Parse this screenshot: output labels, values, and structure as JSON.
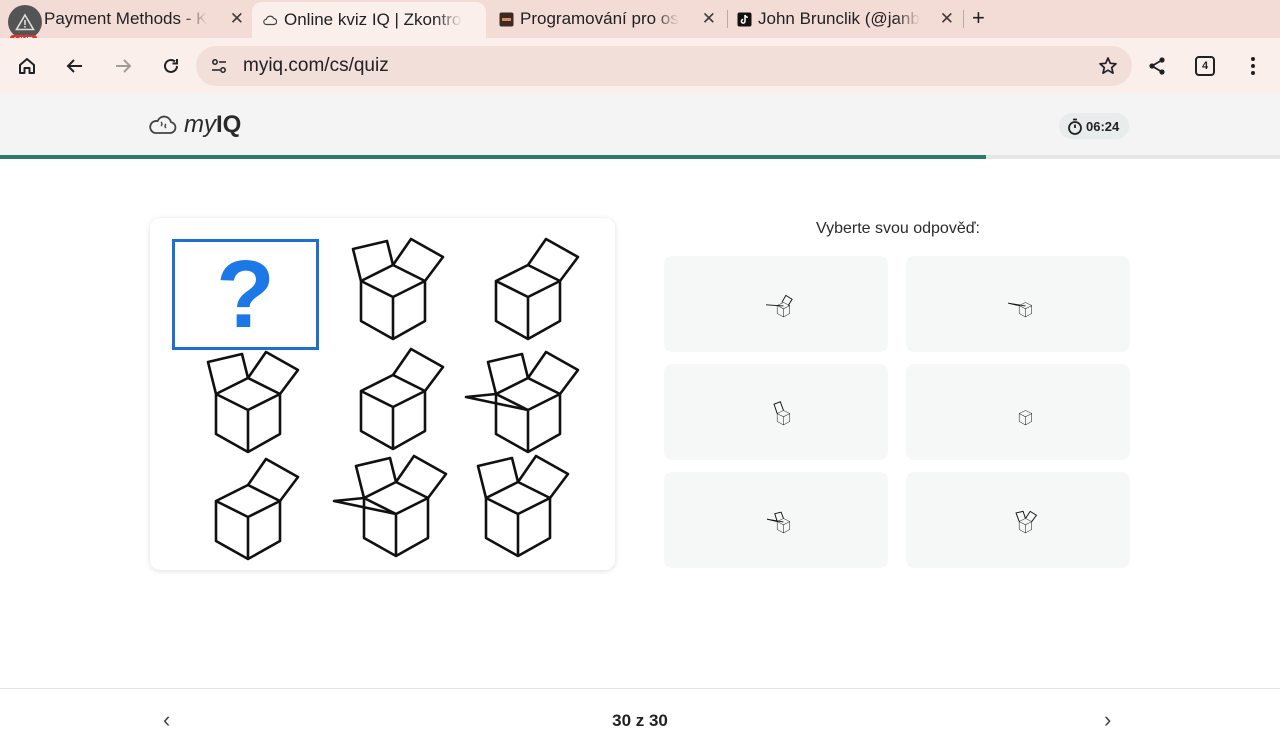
{
  "browser": {
    "live_badge": "LIVE",
    "tabs": [
      {
        "title": "Payment Methods - K"
      },
      {
        "title": "Online kviz IQ | Zkontrolujte"
      },
      {
        "title": "Programování pro os"
      },
      {
        "title": "John Brunclik (@janb"
      }
    ],
    "new_tab": "+",
    "url": "myiq.com/cs/quiz",
    "tab_count": "4"
  },
  "site": {
    "logo_my": "my",
    "logo_iq": "IQ",
    "timer": "06:24",
    "progress": 0.77,
    "accent_color": "#2e7a6a",
    "question_color": "#1b78e6"
  },
  "quiz": {
    "question_mark": "?",
    "prompt": "Vyberte svou odpověď:",
    "grid_cells": [
      "missing",
      "two-flaps-open",
      "one-flap-right",
      "two-flaps-open",
      "one-flap-right",
      "three-flaps-open",
      "one-flap-right",
      "three-flaps-open",
      "two-flaps-open"
    ],
    "options": [
      "box-side-and-back-flaps",
      "box-side-flap",
      "box-top-flap",
      "closed-box",
      "box-three-flaps",
      "box-two-flaps"
    ],
    "counter": "30 z 30"
  },
  "footer": {
    "prev": "‹",
    "next": "›"
  }
}
